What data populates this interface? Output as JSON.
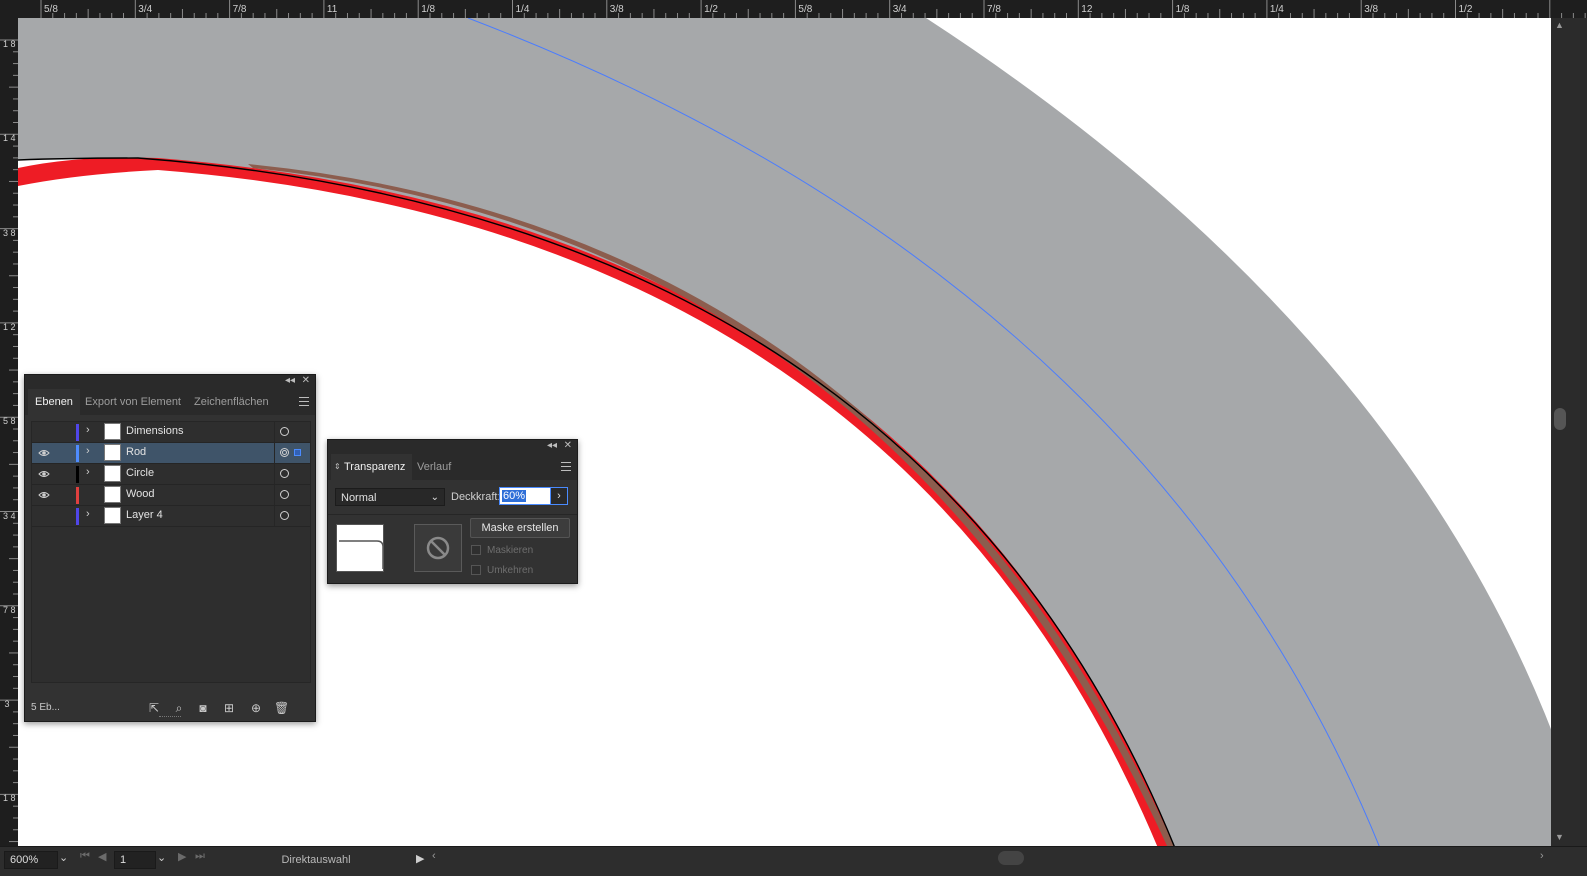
{
  "ruler": {
    "top_labels": [
      "5/8",
      "3/4",
      "7/8",
      "11",
      "1/8",
      "1/4",
      "3/8",
      "1/2",
      "5/8",
      "3/4",
      "7/8",
      "12",
      "1/8",
      "1/4",
      "3/8",
      "1/2"
    ],
    "left_labels": [
      "1 8",
      "1 4",
      "3 8",
      "1 2",
      "5 8",
      "3 4",
      "7 8",
      "3",
      "1 8"
    ]
  },
  "colors": {
    "gray_band": "#a6a8aa",
    "red_band": "#ee1c25",
    "brown_band": "#8c5d4e",
    "guide_line": "#4a7cff",
    "ui_dark": "#323232",
    "selection": "#3f5469"
  },
  "layers_panel": {
    "tabs": [
      {
        "label": "Ebenen",
        "active": true
      },
      {
        "label": "Export von Element",
        "active": false
      },
      {
        "label": "Zeichenflächen",
        "active": false
      }
    ],
    "layers": [
      {
        "name": "Dimensions",
        "visible": false,
        "color": "#5046e8",
        "expandable": true,
        "selected": false
      },
      {
        "name": "Rod",
        "visible": true,
        "color": "#4f8cff",
        "expandable": true,
        "selected": true
      },
      {
        "name": "Circle",
        "visible": true,
        "color": "#000000",
        "expandable": true,
        "selected": false
      },
      {
        "name": "Wood",
        "visible": true,
        "color": "#e0403f",
        "expandable": false,
        "selected": false
      },
      {
        "name": "Layer 4",
        "visible": false,
        "color": "#5046e8",
        "expandable": true,
        "selected": false
      }
    ],
    "footer_count": "5 Eb...",
    "footer_icons": [
      "export-icon",
      "search-icon",
      "clipping-mask-icon",
      "sublayer-icon",
      "new-layer-icon",
      "trash-icon"
    ]
  },
  "transparency_panel": {
    "tabs": [
      {
        "label": "Transparenz",
        "active": true
      },
      {
        "label": "Verlauf",
        "active": false
      }
    ],
    "blend_mode": "Normal",
    "opacity_label": "Deckkraft:",
    "opacity_value": "60%",
    "mask_button": "Maske erstellen",
    "clip_label": "Maskieren",
    "invert_label": "Umkehren"
  },
  "status_bar": {
    "zoom": "600%",
    "artboard": "1",
    "tool": "Direktauswahl"
  }
}
